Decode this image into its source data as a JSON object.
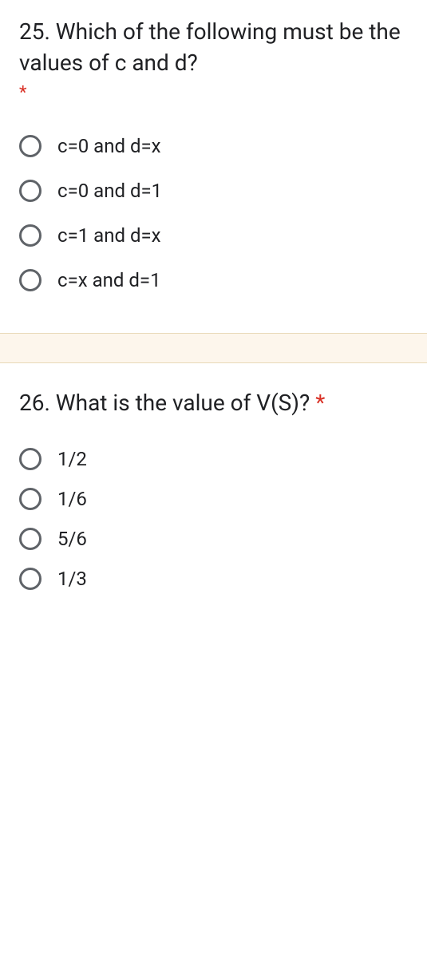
{
  "q25": {
    "title": "25. Which of the following must be the values of c and d?",
    "required": "*",
    "options": [
      "c=0 and d=x",
      "c=0 and d=1",
      "c=1 and d=x",
      "c=x and d=1"
    ]
  },
  "q26": {
    "title": "26. What is the value of V(S)? ",
    "title_star": "*",
    "options": [
      "1/2",
      "1/6",
      "5/6",
      "1/3"
    ]
  }
}
